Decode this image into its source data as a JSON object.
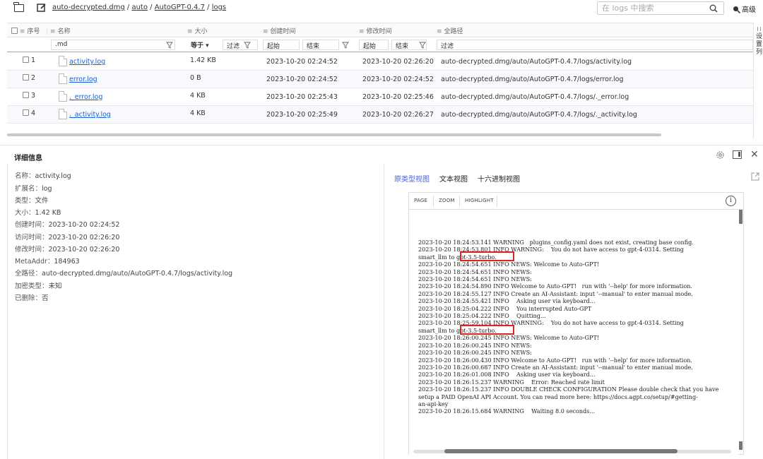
{
  "toolbar": {
    "path": [
      {
        "label": "auto-decrypted.dmg",
        "sep": " / "
      },
      {
        "label": "auto",
        "sep": " / "
      },
      {
        "label": "AutoGPT-0.4.7",
        "sep": " / "
      },
      {
        "label": "logs",
        "sep": ""
      }
    ],
    "search_placeholder": "在 logs 中搜索",
    "advanced_label": "高级"
  },
  "table": {
    "headers": {
      "index": "序号",
      "name": "名称",
      "size": "大小",
      "created": "创建时间",
      "modified": "修改时间",
      "fullpath": "全路径"
    },
    "filters": {
      "name": ".md",
      "size_op": "等于",
      "size_filter": "过滤",
      "created_start": "起始",
      "created_end": "结束",
      "modified_start": "起始",
      "modified_end": "结束",
      "path_filter": "过滤"
    },
    "rows": [
      {
        "index": "1",
        "name": "activity.log",
        "size": "1.42 KB",
        "created": "2023-10-20 02:24:52",
        "modified": "2023-10-20 02:26:20",
        "path": "auto-decrypted.dmg/auto/AutoGPT-0.4.7/logs/activity.log"
      },
      {
        "index": "2",
        "name": "error.log",
        "size": "0 B",
        "created": "2023-10-20 02:24:52",
        "modified": "2023-10-20 02:24:52",
        "path": "auto-decrypted.dmg/auto/AutoGPT-0.4.7/logs/error.log"
      },
      {
        "index": "3",
        "name": "._error.log",
        "size": "4 KB",
        "created": "2023-10-20 02:25:43",
        "modified": "2023-10-20 02:25:46",
        "path": "auto-decrypted.dmg/auto/AutoGPT-0.4.7/logs/._error.log"
      },
      {
        "index": "4",
        "name": "._activity.log",
        "size": "4 KB",
        "created": "2023-10-20 02:25:49",
        "modified": "2023-10-20 02:26:27",
        "path": "auto-decrypted.dmg/auto/AutoGPT-0.4.7/logs/._activity.log"
      }
    ]
  },
  "column_settings_label": "设置列",
  "details": {
    "title": "详细信息",
    "props": [
      {
        "k": "名称：",
        "v": "activity.log"
      },
      {
        "k": "扩展名：",
        "v": "log"
      },
      {
        "k": "类型：",
        "v": "文件"
      },
      {
        "k": "大小：",
        "v": "1.42 KB"
      },
      {
        "k": "创建时间：",
        "v": "2023-10-20 02:24:52"
      },
      {
        "k": "访问时间：",
        "v": "2023-10-20 02:26:20"
      },
      {
        "k": "修改时间：",
        "v": "2023-10-20 02:26:20"
      },
      {
        "k": "MetaAddr：",
        "v": "184963"
      },
      {
        "k": "全路径：",
        "v": "auto-decrypted.dmg/auto/AutoGPT-0.4.7/logs/activity.log"
      },
      {
        "k": "加密类型：",
        "v": "未知"
      },
      {
        "k": "已删除：",
        "v": "否"
      }
    ]
  },
  "viewer": {
    "tabs": [
      "原类型视图",
      "文本视图",
      "十六进制视图"
    ],
    "tools": [
      "PAGE",
      "ZOOM",
      "HIGHLIGHT"
    ],
    "info_glyph": "i",
    "log": "2023-10-20 18:24:53.141 WARNING   plugins_config.yaml does not exist, creating base config.\n2023-10-20 18:24:53.801 INFO WARNING:    You do not have access to gpt-4-0314. Setting\nsmart_llm to gpt-3.5-turbo.\n2023-10-20 18:24:54.651 INFO NEWS: Welcome to Auto-GPT!\n2023-10-20 18:24:54.651 INFO NEWS:\n2023-10-20 18:24:54.651 INFO NEWS:\n2023-10-20 18:24:54.890 INFO Welcome to Auto-GPT!   run with '--help' for more information.\n2023-10-20 18:24:55.127 INFO Create an AI-Assistant: input '--manual' to enter manual mode.\n2023-10-20 18:24:55.421 INFO    Asking user via keyboard...\n2023-10-20 18:25:04.222 INFO    You interrupted Auto-GPT\n2023-10-20 18:25:04.222 INFO    Quitting...\n2023-10-20 18:25:59.104 INFO WARNING:    You do not have access to gpt-4-0314. Setting\nsmart_llm to gpt-3.5-turbo.\n2023-10-20 18:26:00.245 INFO NEWS: Welcome to Auto-GPT!\n2023-10-20 18:26:00.245 INFO NEWS:\n2023-10-20 18:26:00.245 INFO NEWS:\n2023-10-20 18:26:00.430 INFO Welcome to Auto-GPT!   run with '--help' for more information.\n2023-10-20 18:26:00.687 INFO Create an AI-Assistant: input '--manual' to enter manual mode.\n2023-10-20 18:26:01.008 INFO    Asking user via keyboard...\n2023-10-20 18:26:15.237 WARNING    Error: Reached rate limit\n2023-10-20 18:26:15.237 INFO DOUBLE CHECK CONFIGURATION Please double check that you have\nsetup a PAID OpenAI API Account. You can read more here: https://docs.agpt.co/setup/#getting-\nan-api-key\n2023-10-20 18:26:15.684 WARNING    Waiting 8.0 seconds...",
    "highlight_color": "#e0231e"
  }
}
